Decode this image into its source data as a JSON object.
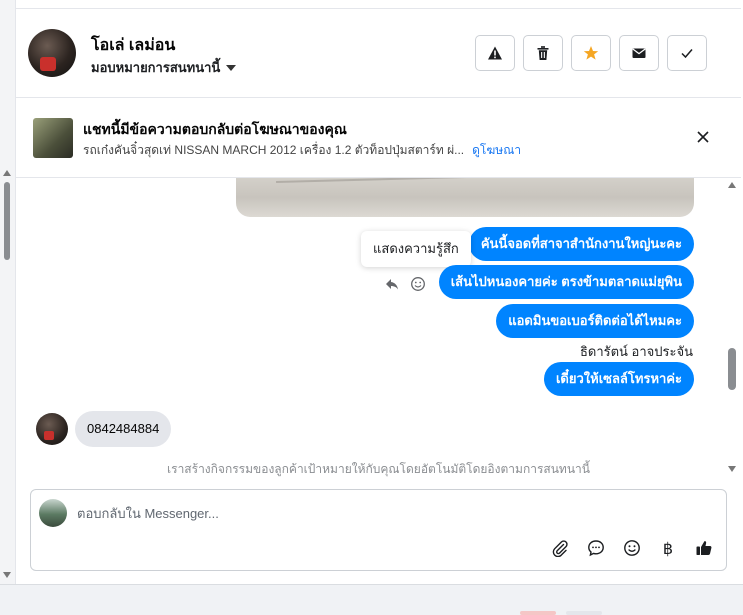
{
  "header": {
    "contact_name": "โอเล่ เลม่อน",
    "assign_label": "มอบหมายการสนทนานี้",
    "actions": [
      {
        "name": "report",
        "icon": "warning-icon"
      },
      {
        "name": "delete",
        "icon": "trash-icon"
      },
      {
        "name": "star",
        "icon": "star-icon",
        "color": "#f7b928"
      },
      {
        "name": "mail",
        "icon": "envelope-icon"
      },
      {
        "name": "done",
        "icon": "check-icon"
      }
    ]
  },
  "ad": {
    "title": "แชทนี้มีข้อความตอบกลับต่อโฆษณาของคุณ",
    "description": "รถเก๋งคันจิ๋วสุดเท่ NISSAN MARCH 2012 เครื่อง 1.2 ตัวท็อปปุ่มสตาร์ท ผ่...",
    "link": "ดูโฆษณา"
  },
  "chat": {
    "tooltip": "แสดงความรู้สึก",
    "outgoing": [
      "คันนี้จอดที่สาจาสำนักงานใหญ่นะคะ",
      "เส้นไปหนองคายค่ะ ตรงข้ามตลาดแม่ยุพิน",
      "แอดมินขอเบอร์ติดต่อได้ไหมคะ"
    ],
    "sender_name": "ธิดารัตน์ อาจประจัน",
    "outgoing_last": "เดี๋ยวให้เซลล์โทรหาค่ะ",
    "incoming": "0842484884",
    "system_note": "เราสร้างกิจกรรมของลูกค้าเป้าหมายให้กับคุณโดยอัตโนมัติโดยอิงตามการสนทนานี้"
  },
  "composer": {
    "placeholder": "ตอบกลับใน Messenger...",
    "currency_symbol": "฿"
  },
  "colors": {
    "accent": "#0084ff",
    "link": "#1877f2"
  }
}
